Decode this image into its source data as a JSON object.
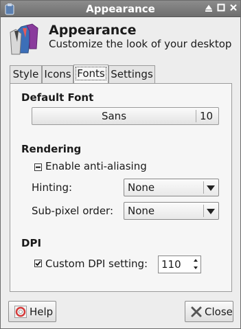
{
  "window": {
    "title": "Appearance"
  },
  "header": {
    "title": "Appearance",
    "subtitle": "Customize the look of your desktop"
  },
  "tabs": [
    {
      "label": "Style",
      "active": false
    },
    {
      "label": "Icons",
      "active": false
    },
    {
      "label": "Fonts",
      "active": true
    },
    {
      "label": "Settings",
      "active": false
    }
  ],
  "default_font": {
    "heading": "Default Font",
    "font_name": "Sans",
    "font_size": "10"
  },
  "rendering": {
    "heading": "Rendering",
    "antialias_label": "Enable anti-aliasing",
    "antialias_state": "mixed",
    "hinting_label": "Hinting:",
    "hinting_value": "None",
    "subpixel_label": "Sub-pixel order:",
    "subpixel_value": "None"
  },
  "dpi": {
    "heading": "DPI",
    "custom_label": "Custom DPI setting:",
    "custom_checked": true,
    "value": "110"
  },
  "footer": {
    "help_label": "Help",
    "close_label": "Close"
  },
  "icons": {
    "app": "shirts-icon",
    "help": "help-lifebuoy-icon",
    "close": "close-x-icon",
    "window_controls": [
      "shade-icon",
      "maximize-icon",
      "close-icon"
    ]
  },
  "colors": {
    "titlebar": "#7d7d7d",
    "panel": "#f6f6f6",
    "window": "#ededed"
  }
}
